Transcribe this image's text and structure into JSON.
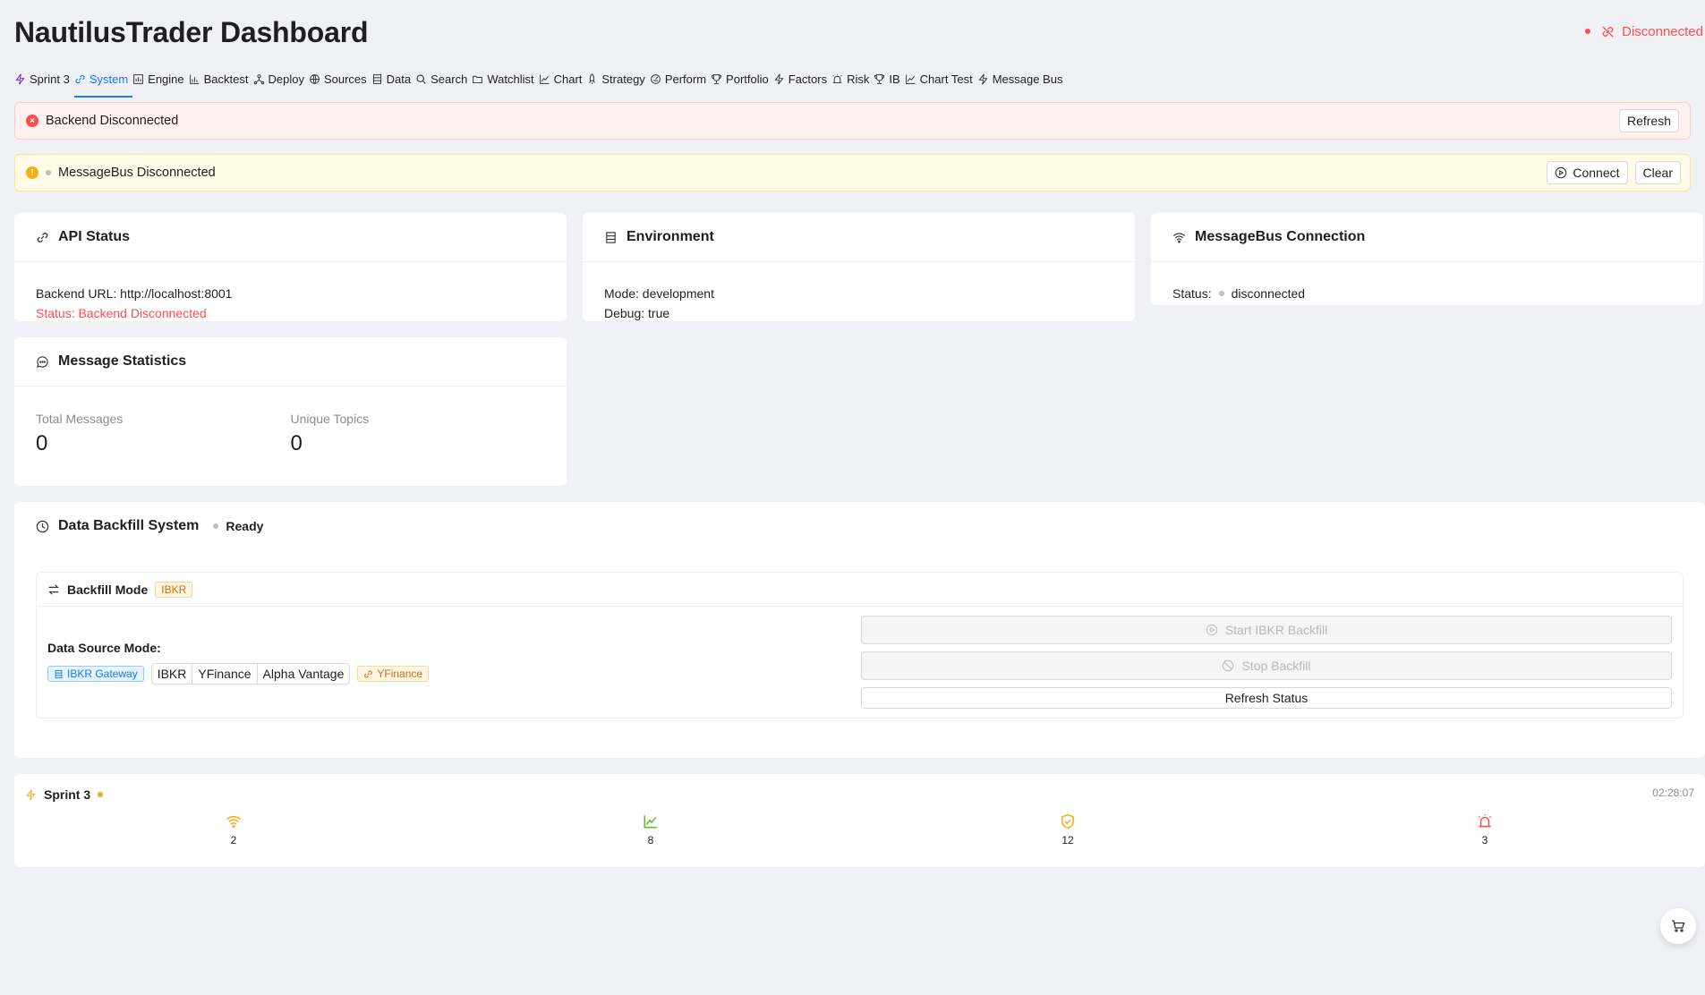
{
  "header": {
    "title": "NautilusTrader Dashboard",
    "connection_status": "Disconnected"
  },
  "tabs": [
    {
      "label": "Sprint 3",
      "icon": "lightning-icon",
      "active": false
    },
    {
      "label": "System",
      "icon": "link-icon",
      "active": true
    },
    {
      "label": "Engine",
      "icon": "dashboard-icon",
      "active": false
    },
    {
      "label": "Backtest",
      "icon": "bar-chart-icon",
      "active": false
    },
    {
      "label": "Deploy",
      "icon": "deploy-icon",
      "active": false
    },
    {
      "label": "Sources",
      "icon": "globe-icon",
      "active": false
    },
    {
      "label": "Data",
      "icon": "database-icon",
      "active": false
    },
    {
      "label": "Search",
      "icon": "search-icon",
      "active": false
    },
    {
      "label": "Watchlist",
      "icon": "folder-icon",
      "active": false
    },
    {
      "label": "Chart",
      "icon": "line-chart-icon",
      "active": false
    },
    {
      "label": "Strategy",
      "icon": "rocket-icon",
      "active": false
    },
    {
      "label": "Perform",
      "icon": "gauge-icon",
      "active": false
    },
    {
      "label": "Portfolio",
      "icon": "trophy-icon",
      "active": false
    },
    {
      "label": "Factors",
      "icon": "lightning-icon",
      "active": false
    },
    {
      "label": "Risk",
      "icon": "alert-icon",
      "active": false
    },
    {
      "label": "IB",
      "icon": "trophy-icon",
      "active": false
    },
    {
      "label": "Chart Test",
      "icon": "line-chart-icon",
      "active": false
    },
    {
      "label": "Message Bus",
      "icon": "lightning-icon",
      "active": false
    }
  ],
  "alerts": {
    "backend": {
      "text": "Backend Disconnected",
      "refresh_label": "Refresh"
    },
    "messagebus": {
      "text": "MessageBus Disconnected",
      "connect_label": "Connect",
      "clear_label": "Clear"
    }
  },
  "api_status": {
    "title": "API Status",
    "backend_url": "Backend URL: http://localhost:8001",
    "status": "Status: Backend Disconnected"
  },
  "environment": {
    "title": "Environment",
    "mode": "Mode: development",
    "debug": "Debug: true"
  },
  "messagebus_connection": {
    "title": "MessageBus Connection",
    "status_label": "Status:",
    "status_value": "disconnected"
  },
  "message_statistics": {
    "title": "Message Statistics",
    "total_label": "Total Messages",
    "total_value": "0",
    "topics_label": "Unique Topics",
    "topics_value": "0"
  },
  "backfill": {
    "title": "Data Backfill System",
    "state": "Ready",
    "mode_title": "Backfill Mode",
    "mode_tag": "IBKR",
    "data_source_label": "Data Source Mode:",
    "gateway_tag": "IBKR Gateway",
    "sources": [
      "IBKR",
      "YFinance",
      "Alpha Vantage"
    ],
    "fallback_tag": "YFinance",
    "start_label": "Start IBKR Backfill",
    "stop_label": "Stop Backfill",
    "refresh_label": "Refresh Status"
  },
  "sprint": {
    "title": "Sprint 3",
    "time": "02:28:07",
    "metrics": [
      {
        "icon": "wifi-icon",
        "value": "2",
        "color": "#faad14"
      },
      {
        "icon": "line-chart-icon",
        "value": "8",
        "color": "#52c41a"
      },
      {
        "icon": "shield-check-icon",
        "value": "12",
        "color": "#faad14"
      },
      {
        "icon": "alarm-icon",
        "value": "3",
        "color": "#ff4d4f"
      }
    ]
  },
  "colors": {
    "accent": "#1677ff",
    "error": "#ff4d4f",
    "warning": "#faad14",
    "success": "#52c41a"
  }
}
